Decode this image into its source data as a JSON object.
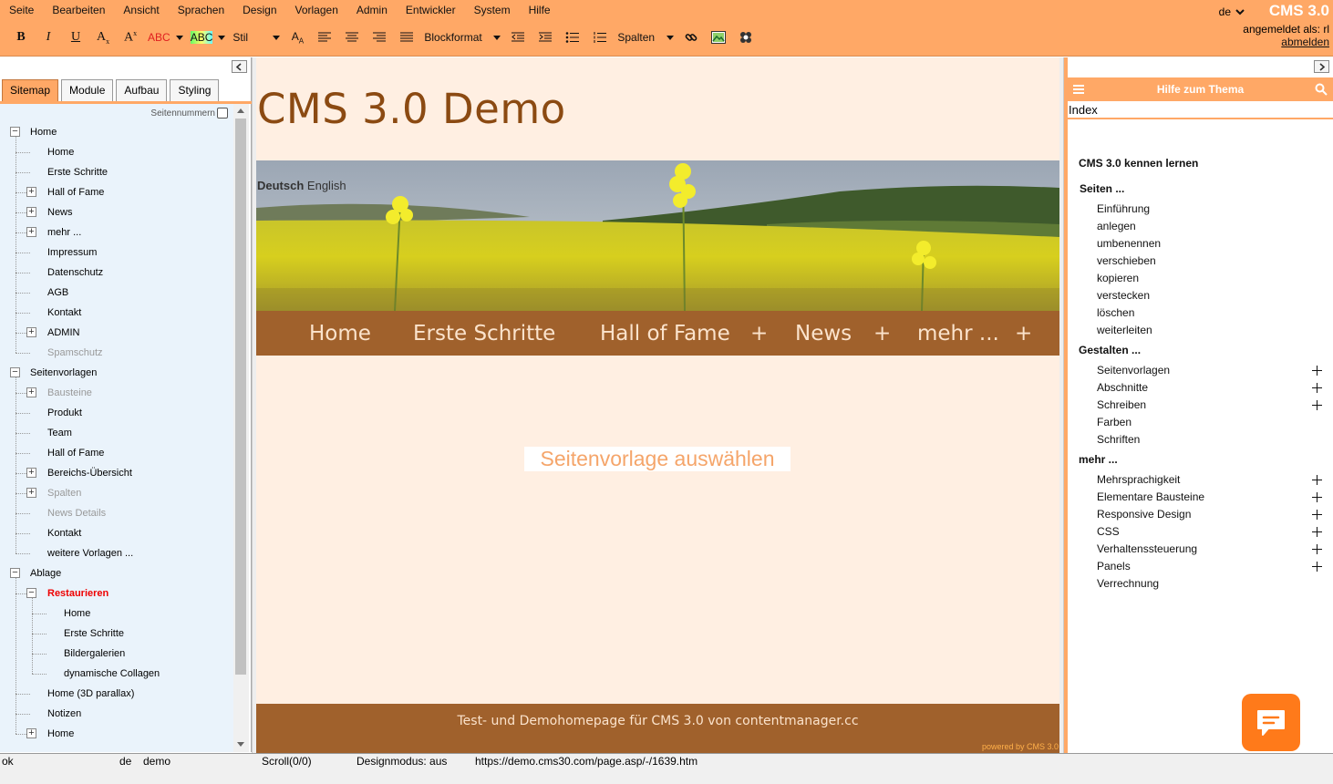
{
  "menu": [
    "Seite",
    "Bearbeiten",
    "Ansicht",
    "Sprachen",
    "Design",
    "Vorlagen",
    "Admin",
    "Entwickler",
    "System",
    "Hilfe"
  ],
  "toolbar": {
    "font_color_label": "ABC",
    "highlight_label": "ABC",
    "style_label": "Stil",
    "blockformat_label": "Blockformat",
    "columns_label": "Spalten"
  },
  "header": {
    "language": "de",
    "app_title": "CMS 3.0",
    "login_text": "angemeldet als: rl",
    "logout": "abmelden"
  },
  "left_panel": {
    "tabs": [
      "Sitemap",
      "Module",
      "Aufbau",
      "Styling"
    ],
    "page_numbers_label": "Seitennummern",
    "tree": [
      {
        "label": "Home",
        "level": 0,
        "toggle": "-",
        "style": ""
      },
      {
        "label": "Home",
        "level": 1,
        "toggle": "",
        "style": ""
      },
      {
        "label": "Erste Schritte",
        "level": 1,
        "toggle": "",
        "style": ""
      },
      {
        "label": "Hall of Fame",
        "level": 1,
        "toggle": "+",
        "style": ""
      },
      {
        "label": "News",
        "level": 1,
        "toggle": "+",
        "style": ""
      },
      {
        "label": "mehr ...",
        "level": 1,
        "toggle": "+",
        "style": ""
      },
      {
        "label": "Impressum",
        "level": 1,
        "toggle": "",
        "style": ""
      },
      {
        "label": "Datenschutz",
        "level": 1,
        "toggle": "",
        "style": ""
      },
      {
        "label": "AGB",
        "level": 1,
        "toggle": "",
        "style": ""
      },
      {
        "label": "Kontakt",
        "level": 1,
        "toggle": "",
        "style": ""
      },
      {
        "label": "ADMIN",
        "level": 1,
        "toggle": "+",
        "style": ""
      },
      {
        "label": "Spamschutz",
        "level": 1,
        "toggle": "",
        "style": "dim"
      },
      {
        "label": "Seitenvorlagen",
        "level": 0,
        "toggle": "-",
        "style": ""
      },
      {
        "label": "Bausteine",
        "level": 1,
        "toggle": "+",
        "style": "dim"
      },
      {
        "label": "Produkt",
        "level": 1,
        "toggle": "",
        "style": ""
      },
      {
        "label": "Team",
        "level": 1,
        "toggle": "",
        "style": ""
      },
      {
        "label": "Hall of Fame",
        "level": 1,
        "toggle": "",
        "style": ""
      },
      {
        "label": "Bereichs-Übersicht",
        "level": 1,
        "toggle": "+",
        "style": ""
      },
      {
        "label": "Spalten",
        "level": 1,
        "toggle": "+",
        "style": "dim"
      },
      {
        "label": "News Details",
        "level": 1,
        "toggle": "",
        "style": "dim"
      },
      {
        "label": "Kontakt",
        "level": 1,
        "toggle": "",
        "style": ""
      },
      {
        "label": "weitere Vorlagen ...",
        "level": 1,
        "toggle": "",
        "style": ""
      },
      {
        "label": "Ablage",
        "level": 0,
        "toggle": "-",
        "style": ""
      },
      {
        "label": "Restaurieren",
        "level": 1,
        "toggle": "-",
        "style": "red"
      },
      {
        "label": "Home",
        "level": 2,
        "toggle": "",
        "style": ""
      },
      {
        "label": "Erste Schritte",
        "level": 2,
        "toggle": "",
        "style": ""
      },
      {
        "label": "Bildergalerien",
        "level": 2,
        "toggle": "",
        "style": ""
      },
      {
        "label": "dynamische Collagen",
        "level": 2,
        "toggle": "",
        "style": ""
      },
      {
        "label": "Home (3D parallax)",
        "level": 1,
        "toggle": "",
        "style": ""
      },
      {
        "label": "Notizen",
        "level": 1,
        "toggle": "",
        "style": ""
      },
      {
        "label": "Home",
        "level": 1,
        "toggle": "+",
        "style": ""
      }
    ]
  },
  "site": {
    "title": "CMS 3.0 Demo",
    "lang_active": "Deutsch",
    "lang_other": "English",
    "nav": [
      {
        "label": "Home",
        "plus": ""
      },
      {
        "label": "Erste Schritte",
        "plus": ""
      },
      {
        "label": "Hall of Fame",
        "plus": "+"
      },
      {
        "label": "News",
        "plus": "+"
      },
      {
        "label": "mehr ...",
        "plus": "+"
      }
    ],
    "template_button": "Seitenvorlage auswählen",
    "footer": "Test- und Demohomepage für CMS 3.0 von contentmanager.cc",
    "powered": "powered by CMS 3.0"
  },
  "help": {
    "title": "Hilfe zum Thema",
    "index": "Index",
    "items": [
      {
        "label": "CMS 3.0 kennen lernen",
        "kind": "head",
        "indent": 0,
        "plus": false
      },
      {
        "label": "Seiten ...",
        "kind": "head",
        "indent": 1,
        "plus": false
      },
      {
        "label": "Einführung",
        "kind": "item",
        "indent": 2,
        "plus": false
      },
      {
        "label": "anlegen",
        "kind": "item",
        "indent": 2,
        "plus": false
      },
      {
        "label": "umbenennen",
        "kind": "item",
        "indent": 2,
        "plus": false
      },
      {
        "label": "verschieben",
        "kind": "item",
        "indent": 2,
        "plus": false
      },
      {
        "label": "kopieren",
        "kind": "item",
        "indent": 2,
        "plus": false
      },
      {
        "label": "verstecken",
        "kind": "item",
        "indent": 2,
        "plus": false
      },
      {
        "label": "löschen",
        "kind": "item",
        "indent": 2,
        "plus": false
      },
      {
        "label": "weiterleiten",
        "kind": "item",
        "indent": 2,
        "plus": false
      },
      {
        "label": "Gestalten ...",
        "kind": "head",
        "indent": 0,
        "plus": false
      },
      {
        "label": "Seitenvorlagen",
        "kind": "item",
        "indent": 2,
        "plus": true
      },
      {
        "label": "Abschnitte",
        "kind": "item",
        "indent": 2,
        "plus": true
      },
      {
        "label": "Schreiben",
        "kind": "item",
        "indent": 2,
        "plus": true
      },
      {
        "label": "Farben",
        "kind": "item",
        "indent": 2,
        "plus": false
      },
      {
        "label": "Schriften",
        "kind": "item",
        "indent": 2,
        "plus": false
      },
      {
        "label": "mehr ...",
        "kind": "head",
        "indent": 0,
        "plus": false
      },
      {
        "label": "Mehrsprachigkeit",
        "kind": "item",
        "indent": 2,
        "plus": true
      },
      {
        "label": "Elementare Bausteine",
        "kind": "item",
        "indent": 2,
        "plus": true
      },
      {
        "label": "Responsive Design",
        "kind": "item",
        "indent": 2,
        "plus": true
      },
      {
        "label": "CSS",
        "kind": "item",
        "indent": 2,
        "plus": true
      },
      {
        "label": "Verhaltenssteuerung",
        "kind": "item",
        "indent": 2,
        "plus": true
      },
      {
        "label": "Panels",
        "kind": "item",
        "indent": 2,
        "plus": true
      },
      {
        "label": "Verrechnung",
        "kind": "item",
        "indent": 2,
        "plus": false
      }
    ]
  },
  "status": {
    "state": "ok",
    "language": "de",
    "project": "demo",
    "scroll": "Scroll(0/0)",
    "design_mode": "Designmodus: aus",
    "url": "https://demo.cms30.com/page.asp/-/1639.htm"
  },
  "colors": {
    "accent": "#ffa866",
    "site_brown": "#a0612c",
    "site_title": "#8b4a12",
    "tree_bg": "#eaf3fb",
    "chat_button": "#ff7a1a"
  }
}
